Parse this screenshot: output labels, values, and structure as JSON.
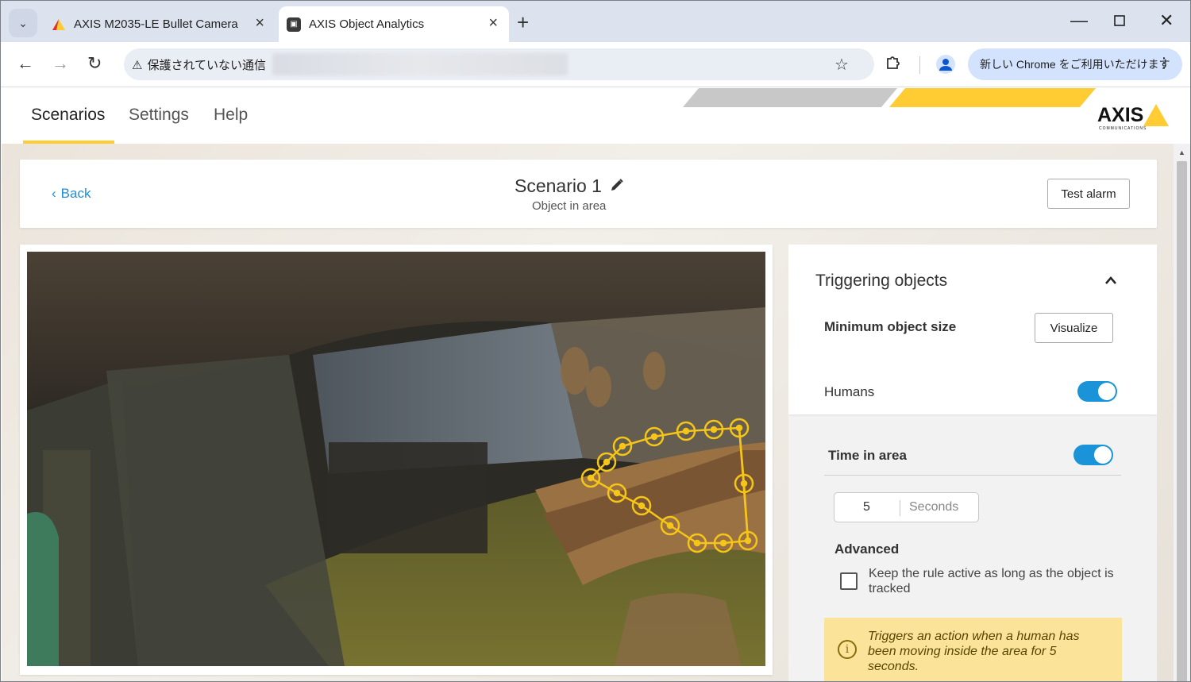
{
  "browser": {
    "tabs": [
      {
        "title": "AXIS M2035-LE Bullet Camera"
      },
      {
        "title": "AXIS Object Analytics"
      }
    ],
    "security_warning": "保護されていない通信",
    "promo": "新しい Chrome をご利用いただけます"
  },
  "nav": {
    "items": [
      {
        "label": "Scenarios"
      },
      {
        "label": "Settings"
      },
      {
        "label": "Help"
      }
    ]
  },
  "logo": {
    "word": "AXIS",
    "sub": "COMMUNICATIONS"
  },
  "header": {
    "back_label": "Back",
    "title": "Scenario 1",
    "subtitle": "Object in area",
    "test_alarm_label": "Test alarm"
  },
  "panel": {
    "section_title": "Triggering objects",
    "min_size_label": "Minimum object size",
    "visualize_label": "Visualize",
    "humans_label": "Humans",
    "humans_enabled": true,
    "time_in_area_label": "Time in area",
    "time_in_area_enabled": true,
    "time_value": "5",
    "time_unit_placeholder": "Seconds",
    "advanced_label": "Advanced",
    "keep_active_label": "Keep the rule active as long as the object is tracked",
    "keep_active_checked": false,
    "info_text": "Triggers an action when a human has been moving inside the area for 5 seconds."
  },
  "colors": {
    "accent": "#ffcc33",
    "toggle": "#1a93d8",
    "link": "#1d8ed8",
    "info_bg": "#fbe39a"
  }
}
